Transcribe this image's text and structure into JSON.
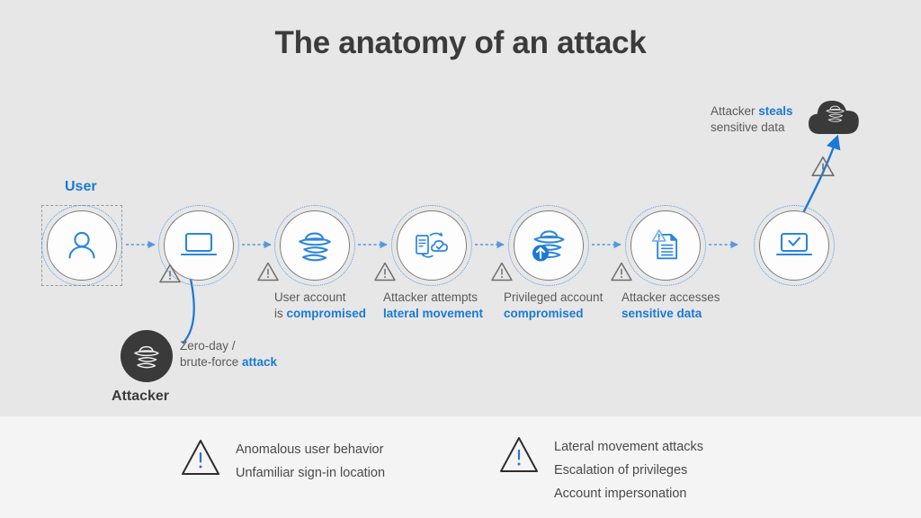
{
  "title": "The anatomy of an attack",
  "colors": {
    "background": "#e7e7e7",
    "footer_band": "#f4f4f4",
    "accent_blue": "#1b79d4",
    "icon_blue": "#2b86dd",
    "dark": "#3a3a3a",
    "text_gray": "#5a5a5a",
    "node_border": "#7d7d7d"
  },
  "user_label": "User",
  "attacker_label": "Attacker",
  "attacker_caption": {
    "line1": "Zero-day /",
    "line2_plain": "brute-force ",
    "line2_accent": "attack"
  },
  "cloud_caption": {
    "line1_plain": "Attacker ",
    "line1_accent": "steals",
    "line2": "sensitive data"
  },
  "nodes": [
    {
      "icon": "person-icon",
      "caption_line1": "",
      "caption_plain": "",
      "caption_accent": "",
      "caption_line2_plain": ""
    },
    {
      "icon": "laptop-icon",
      "caption_line1": "",
      "caption_plain": "",
      "caption_accent": "",
      "caption_line2_plain": ""
    },
    {
      "icon": "spy-hat-icon",
      "caption_line1": "User account",
      "caption_line2_plain": "is ",
      "caption_accent": "compromised"
    },
    {
      "icon": "server-cloud-sync-icon",
      "caption_line1": "Attacker attempts",
      "caption_line2_plain": "",
      "caption_accent": "lateral movement"
    },
    {
      "icon": "spy-elevated-icon",
      "caption_line1": "Privileged account",
      "caption_line2_plain": "",
      "caption_accent": "compromised"
    },
    {
      "icon": "document-warning-icon",
      "caption_line1": "Attacker accesses",
      "caption_line2_plain": "",
      "caption_accent": "sensitive data"
    },
    {
      "icon": "laptop-check-icon",
      "caption_line1": "",
      "caption_line2_plain": "",
      "caption_accent": ""
    }
  ],
  "legend": {
    "left": {
      "icon": "warning-triangle-icon",
      "items": [
        "Anomalous user behavior",
        "Unfamiliar sign-in location"
      ]
    },
    "right": {
      "icon": "warning-triangle-icon",
      "items": [
        "Lateral movement attacks",
        "Escalation of privileges",
        "Account impersonation"
      ]
    }
  }
}
